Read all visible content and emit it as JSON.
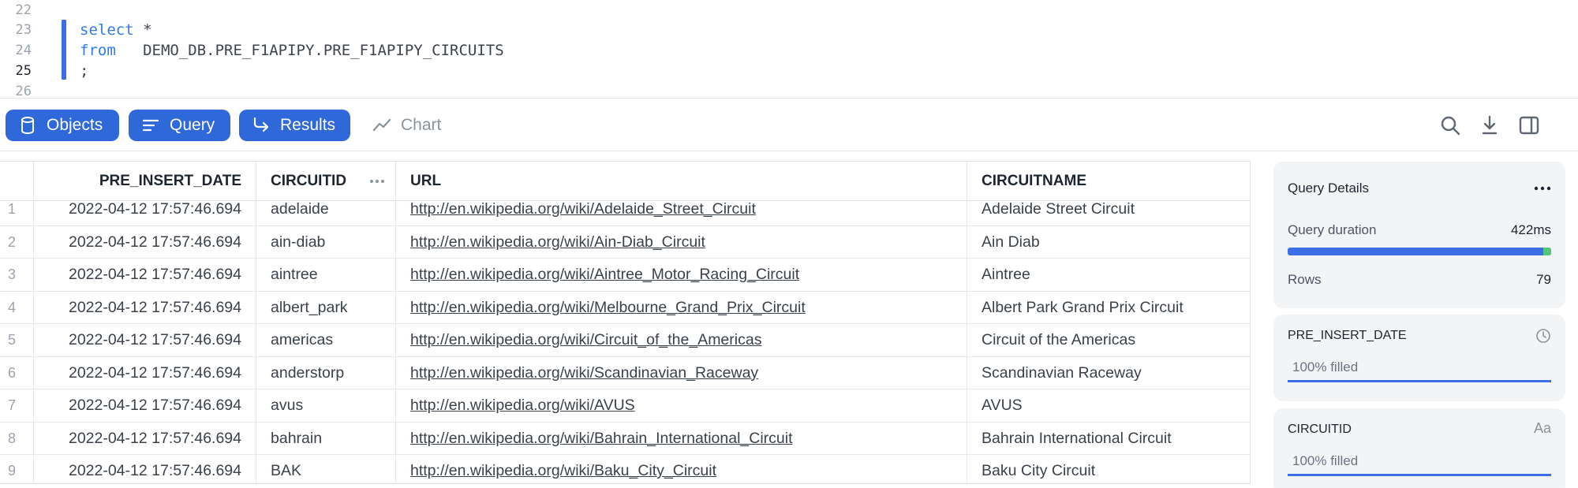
{
  "editor": {
    "lines": [
      {
        "num": "22",
        "code": ""
      },
      {
        "num": "23",
        "kw": "select",
        "code": " *"
      },
      {
        "num": "24",
        "kw": "from",
        "code": "   DEMO_DB.PRE_F1APIPY.PRE_F1APIPY_CIRCUITS"
      },
      {
        "num": "25",
        "code": ";"
      },
      {
        "num": "26",
        "code": ""
      }
    ]
  },
  "toolbar": {
    "objects_label": "Objects",
    "query_label": "Query",
    "results_label": "Results",
    "chart_label": "Chart",
    "accent": "#2f68d9"
  },
  "table": {
    "columns": [
      "PRE_INSERT_DATE",
      "CIRCUITID",
      "URL",
      "CIRCUITNAME"
    ],
    "rows": [
      {
        "idx": "1",
        "date": "2022-04-12 17:57:46.694",
        "id": "adelaide",
        "url": "http://en.wikipedia.org/wiki/Adelaide_Street_Circuit",
        "name": "Adelaide Street Circuit"
      },
      {
        "idx": "2",
        "date": "2022-04-12 17:57:46.694",
        "id": "ain-diab",
        "url": "http://en.wikipedia.org/wiki/Ain-Diab_Circuit",
        "name": "Ain Diab"
      },
      {
        "idx": "3",
        "date": "2022-04-12 17:57:46.694",
        "id": "aintree",
        "url": "http://en.wikipedia.org/wiki/Aintree_Motor_Racing_Circuit",
        "name": "Aintree"
      },
      {
        "idx": "4",
        "date": "2022-04-12 17:57:46.694",
        "id": "albert_park",
        "url": "http://en.wikipedia.org/wiki/Melbourne_Grand_Prix_Circuit",
        "name": "Albert Park Grand Prix Circuit"
      },
      {
        "idx": "5",
        "date": "2022-04-12 17:57:46.694",
        "id": "americas",
        "url": "http://en.wikipedia.org/wiki/Circuit_of_the_Americas",
        "name": "Circuit of the Americas"
      },
      {
        "idx": "6",
        "date": "2022-04-12 17:57:46.694",
        "id": "anderstorp",
        "url": "http://en.wikipedia.org/wiki/Scandinavian_Raceway",
        "name": "Scandinavian Raceway"
      },
      {
        "idx": "7",
        "date": "2022-04-12 17:57:46.694",
        "id": "avus",
        "url": "http://en.wikipedia.org/wiki/AVUS",
        "name": "AVUS"
      },
      {
        "idx": "8",
        "date": "2022-04-12 17:57:46.694",
        "id": "bahrain",
        "url": "http://en.wikipedia.org/wiki/Bahrain_International_Circuit",
        "name": "Bahrain International Circuit"
      },
      {
        "idx": "9",
        "date": "2022-04-12 17:57:46.694",
        "id": "BAK",
        "url": "http://en.wikipedia.org/wiki/Baku_City_Circuit",
        "name": "Baku City Circuit"
      }
    ]
  },
  "query_details": {
    "title": "Query Details",
    "duration_label": "Query duration",
    "duration_value": "422ms",
    "duration_bar_fraction": 0.97,
    "rows_label": "Rows",
    "rows_value": "79"
  },
  "column_stats": [
    {
      "name": "PRE_INSERT_DATE",
      "filled": "100% filled",
      "type_icon": "clock-icon"
    },
    {
      "name": "CIRCUITID",
      "filled": "100% filled",
      "type_icon": "Aa"
    }
  ]
}
